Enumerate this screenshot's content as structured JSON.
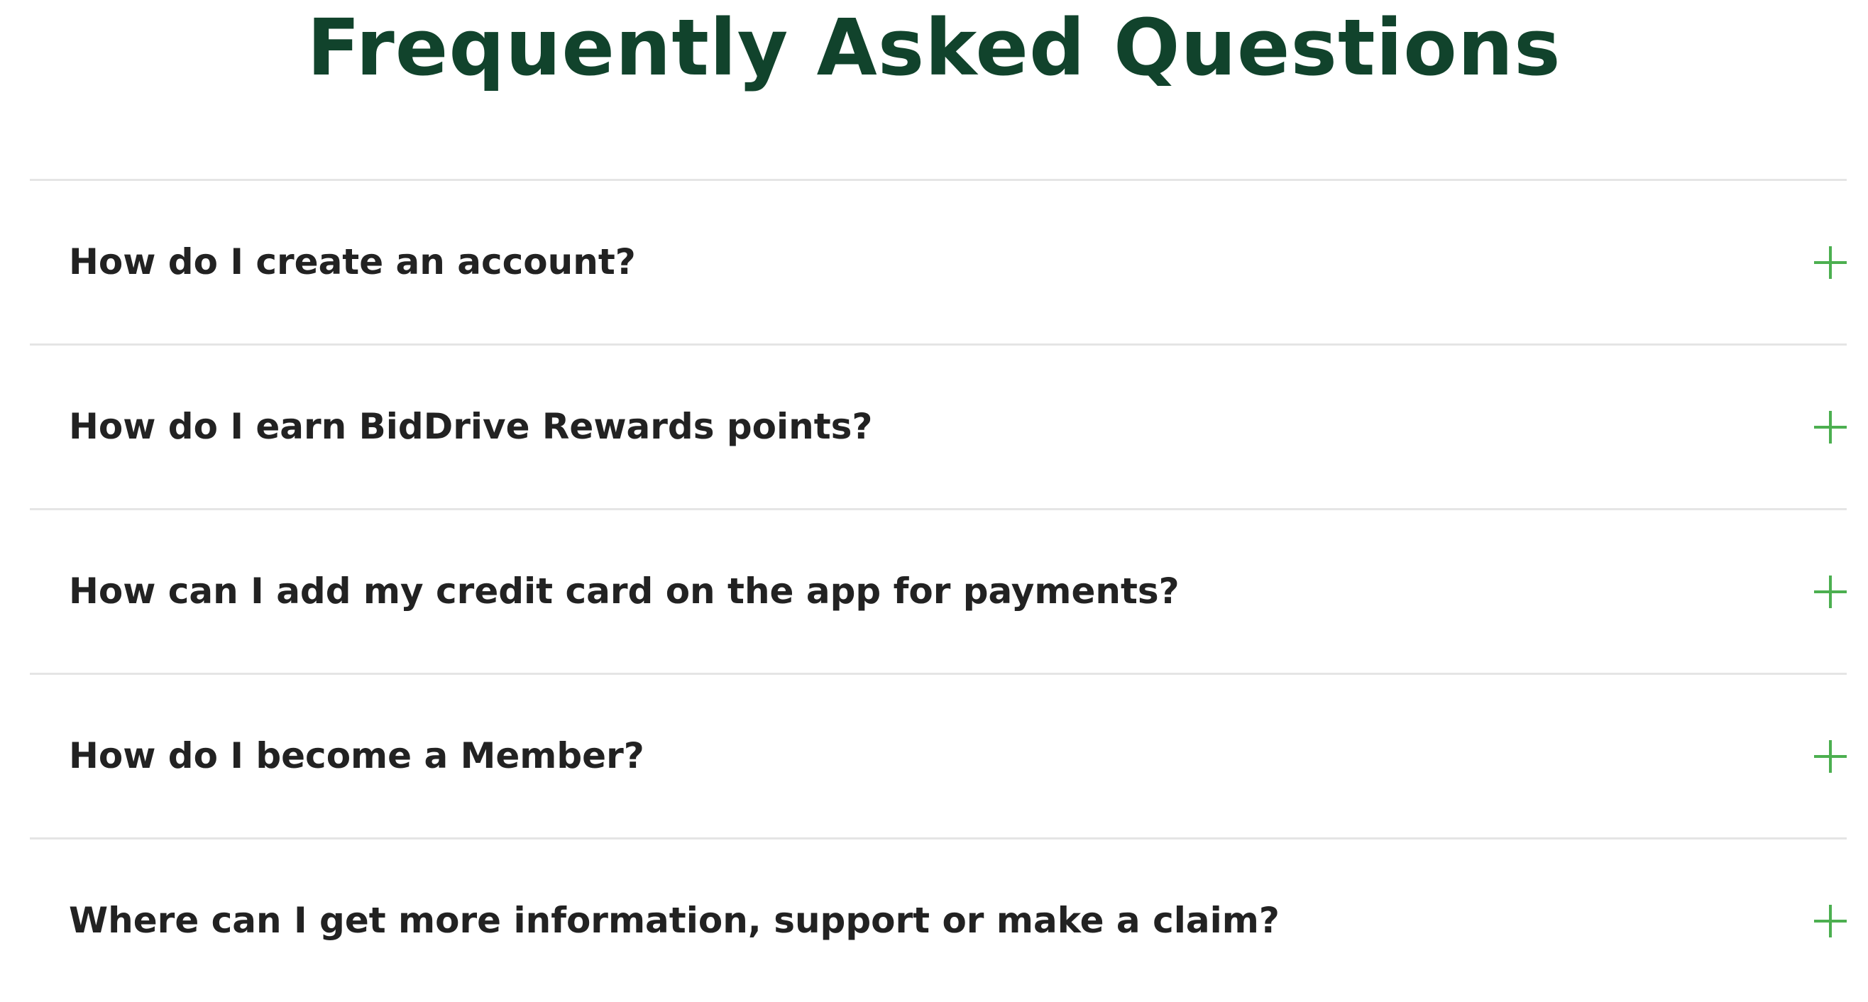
{
  "faq": {
    "title": "Frequently Asked Questions",
    "accent_color": "#4caf50",
    "title_color": "#11432c",
    "items": [
      {
        "question": "How do I create an account?",
        "icon": "plus-icon",
        "expanded": false
      },
      {
        "question": "How do I earn BidDrive Rewards points?",
        "icon": "plus-icon",
        "expanded": false
      },
      {
        "question": "How can I add my credit card on the app for payments?",
        "icon": "plus-icon",
        "expanded": false
      },
      {
        "question": "How do I become a Member?",
        "icon": "plus-icon",
        "expanded": false
      },
      {
        "question": "Where can I get more information, support or make a claim?",
        "icon": "plus-icon",
        "expanded": false
      }
    ]
  }
}
